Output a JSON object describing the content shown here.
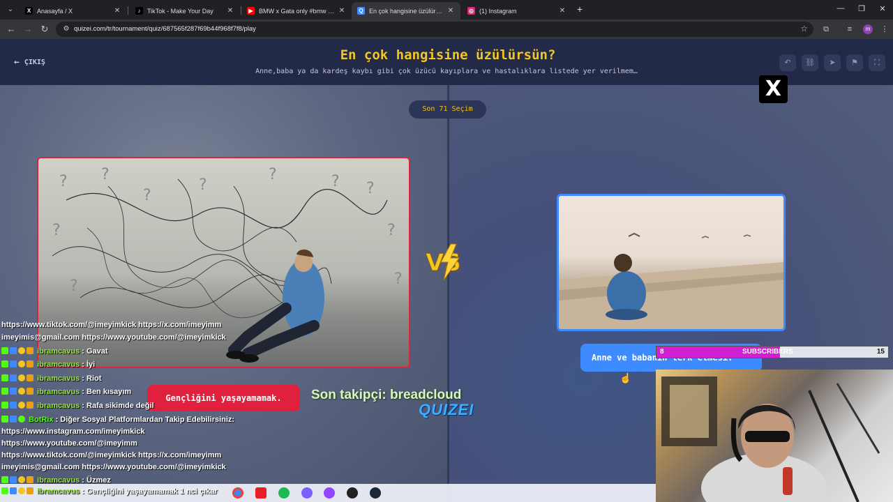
{
  "browser": {
    "tabs": [
      {
        "title": "Anasayfa / X",
        "icon": "x-icon",
        "color": "#000000"
      },
      {
        "title": "TikTok - Make Your Day",
        "icon": "tiktok-icon",
        "color": "#000000"
      },
      {
        "title": "BMW x Gata only #bmw #edit",
        "icon": "youtube-icon",
        "color": "#ff0000"
      },
      {
        "title": "En çok hangisine üzülürsün? -",
        "icon": "quizei-icon",
        "color": "#3d8bff"
      },
      {
        "title": "(1) Instagram",
        "icon": "instagram-icon",
        "color": "#d62976"
      }
    ],
    "active_tab": 3,
    "url": "quizei.com/tr/tournament/quiz/687565f287f69b44f968f7f8/play",
    "profile_initial": "m"
  },
  "quiz": {
    "exit_label": "ÇIKIŞ",
    "title": "En çok hangisine üzülürsün?",
    "subtitle": "Anne,baba ya da kardeş kaybı gibi çok üzücü kayıplara ve hastalıklara listede yer verilmem…",
    "choices_remaining": "Son 71 Seçim",
    "left_option": "Gençliğini yaşayamamak.",
    "right_option": "Anne ve babanın terk etmesi."
  },
  "colors": {
    "accent_yellow": "#f3c623",
    "left_red": "#e0203c",
    "right_blue": "#3d8bff",
    "page_bg": "#222a47"
  },
  "stream": {
    "x_logo": "X",
    "chat": [
      {
        "text": "https://www.tiktok.com/@imeyimkick https://x.com/imeyimm"
      },
      {
        "text": "imeyimis@gmail.com https://www.youtube.com/@imeyimkick"
      },
      {
        "user": "ibramcavus",
        "msg": " : Gavat"
      },
      {
        "user": "ibramcavus",
        "msg": " : İyi"
      },
      {
        "user": "ibramcavus",
        "msg": " : Riot"
      },
      {
        "user": "ibramcavus",
        "msg": " : Ben kısayım"
      },
      {
        "user": "ibramcavus",
        "msg": " : Rafa sikimde değil"
      },
      {
        "user": "BotRix",
        "msg": " : Diğer Sosyal Platformlardan Takip Edebilirsiniz:"
      },
      {
        "text": "https://www.instagram.com/imeyimkick"
      },
      {
        "text": "https://www.youtube.com/@imeyimm"
      },
      {
        "text": "https://www.tiktok.com/@imeyimkick https://x.com/imeyimm"
      },
      {
        "text": "imeyimis@gmail.com https://www.youtube.com/@imeyimkick"
      },
      {
        "user": "ibramcavus",
        "msg": " : Üzmez"
      },
      {
        "user": "ibramcavus",
        "msg": " : Gençliğini yaşayamamak 1 nci çıkar"
      }
    ],
    "last_follower": "Son takipçi: breadcloud",
    "brand": "QUIZEI",
    "subscribers": {
      "current": "8",
      "label": "SUBSCRIBERS",
      "goal": "15",
      "progress": 0.533
    }
  }
}
